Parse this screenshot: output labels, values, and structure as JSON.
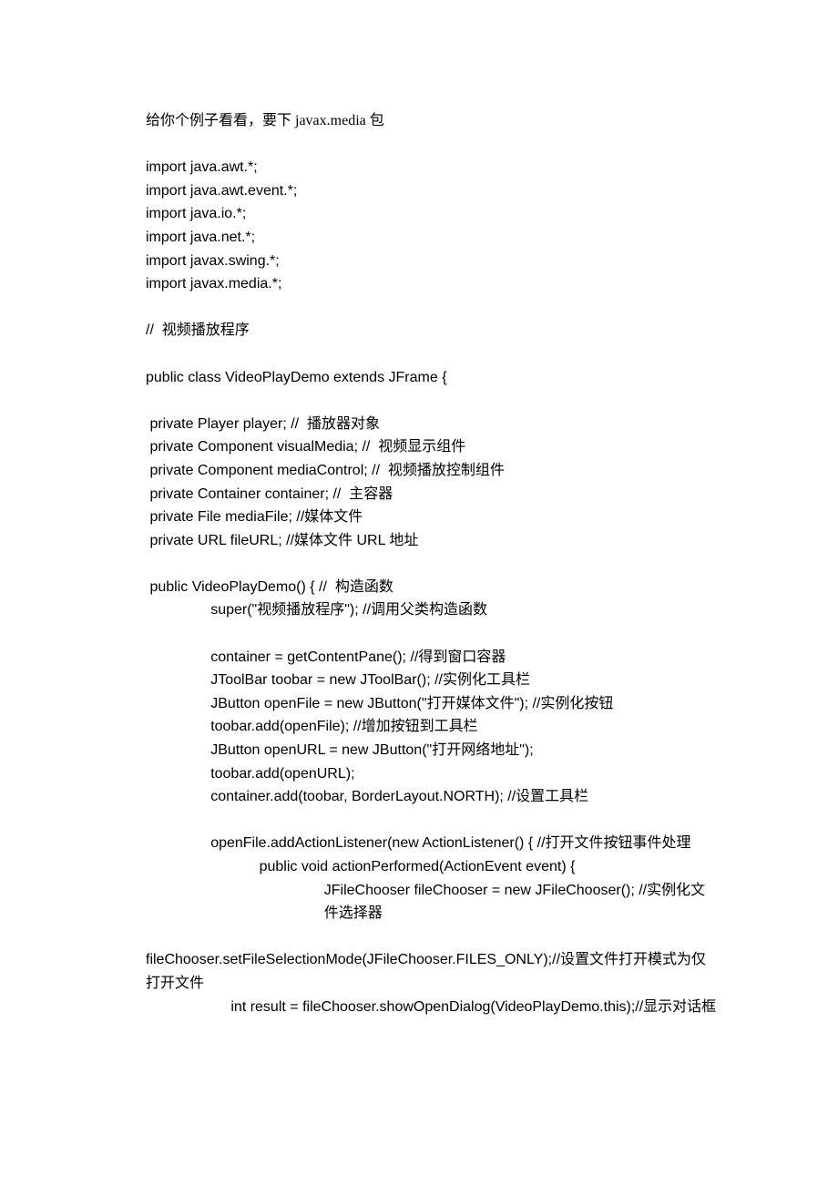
{
  "lines": {
    "l1": "给你个例子看看，要下 javax.media 包",
    "l2": "import java.awt.*;",
    "l3": "import java.awt.event.*;",
    "l4": "import java.io.*;",
    "l5": "import java.net.*;",
    "l6": "import javax.swing.*;",
    "l7": "import javax.media.*;",
    "l8": "//  视频播放程序",
    "l9": "public class VideoPlayDemo extends JFrame {",
    "l10": " private Player player; //  播放器对象",
    "l11": " private Component visualMedia; //  视频显示组件",
    "l12": " private Component mediaControl; //  视频播放控制组件",
    "l13": " private Container container; //  主容器",
    "l14": " private File mediaFile; //媒体文件",
    "l15": " private URL fileURL; //媒体文件 URL 地址",
    "l16": " public VideoPlayDemo() { //  构造函数",
    "l17": "super(\"视频播放程序\"); //调用父类构造函数",
    "l18": "container = getContentPane(); //得到窗口容器",
    "l19": "JToolBar toobar = new JToolBar(); //实例化工具栏",
    "l20": "JButton openFile = new JButton(\"打开媒体文件\"); //实例化按钮",
    "l21": "toobar.add(openFile); //增加按钮到工具栏",
    "l22": "JButton openURL = new JButton(\"打开网络地址\");",
    "l23": "toobar.add(openURL);",
    "l24": "container.add(toobar, BorderLayout.NORTH); //设置工具栏",
    "l25": "openFile.addActionListener(new ActionListener() { //打开文件按钮事件处理",
    "l26": "public void actionPerformed(ActionEvent event) {",
    "l27": "JFileChooser fileChooser = new JFileChooser(); //实例化文件选择器",
    "l28": "fileChooser.setFileSelectionMode(JFileChooser.FILES_ONLY);//设置文件打开模式为仅打开文件",
    "l29": "                     int result = fileChooser.showOpenDialog(VideoPlayDemo.this);//显示对话框"
  }
}
